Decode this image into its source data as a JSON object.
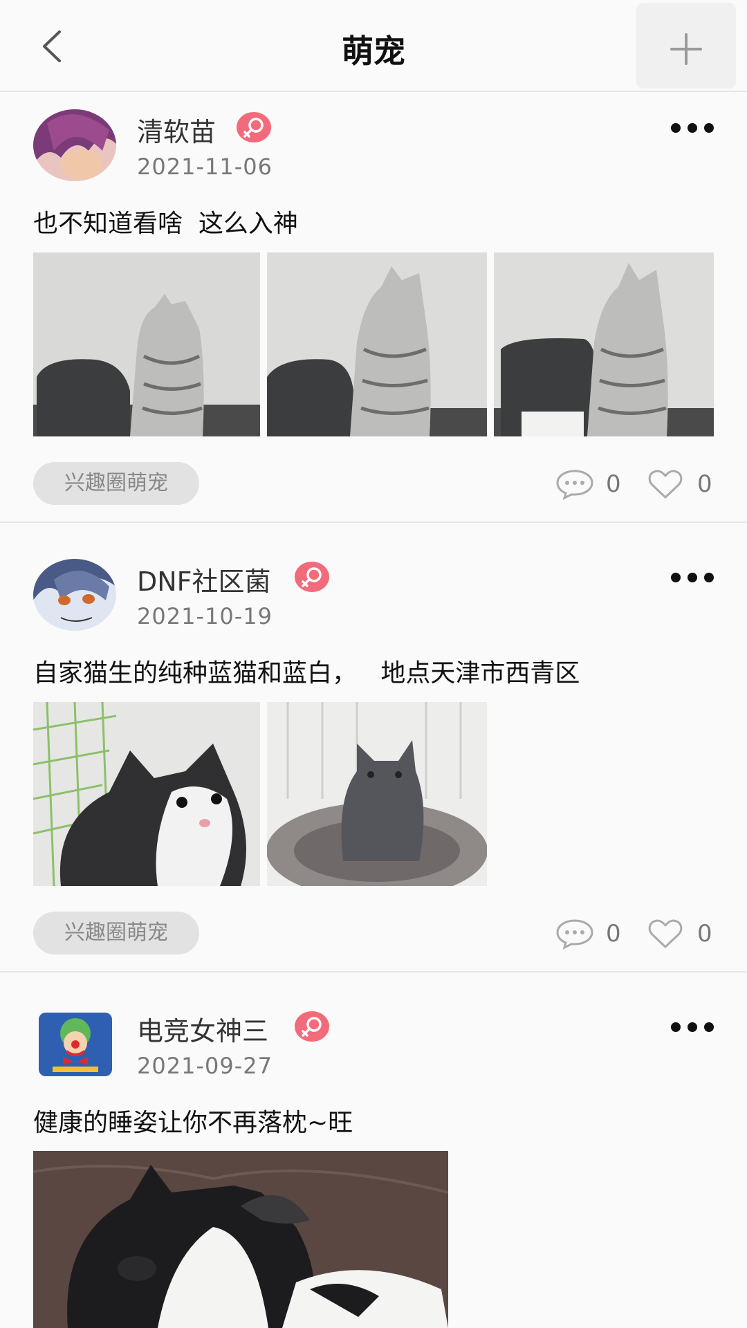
{
  "header": {
    "title": "萌宠",
    "back_icon": "chevron-left-icon",
    "add_icon": "plus-icon"
  },
  "colors": {
    "background": "#fafafa",
    "gender_badge": "#f26b7a",
    "tag_bg": "#e2e2e2",
    "muted_text": "#777777"
  },
  "posts": [
    {
      "username": "清软苗",
      "date": "2021-11-06",
      "content": "也不知道看啥  这么入神",
      "image_count": 3,
      "tag": "兴趣圈萌宠",
      "comments": "0",
      "likes": "0"
    },
    {
      "username": "DNF社区菌",
      "date": "2021-10-19",
      "content": "自家猫生的纯种蓝猫和蓝白，   地点天津市西青区",
      "image_count": 2,
      "tag": "兴趣圈萌宠",
      "comments": "0",
      "likes": "0"
    },
    {
      "username": "电竞女神三",
      "date": "2021-09-27",
      "content": "健康的睡姿让你不再落枕~旺",
      "image_count": 1
    }
  ]
}
